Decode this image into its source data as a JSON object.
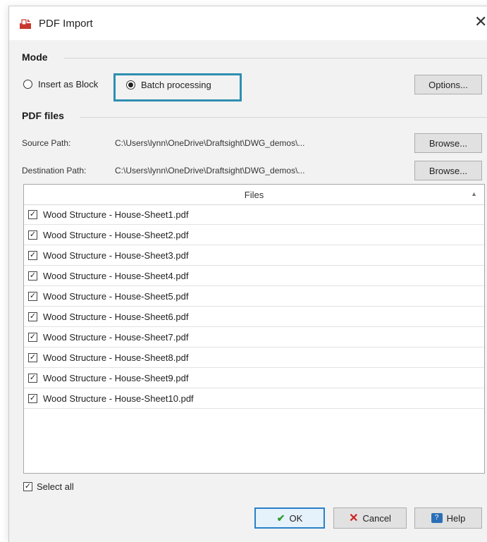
{
  "window": {
    "title": "PDF Import",
    "close": "✕",
    "app_icon": "pdf-import-icon"
  },
  "mode": {
    "label": "Mode",
    "insert_block": "Insert as Block",
    "batch": "Batch processing",
    "selected": "Batch processing",
    "options_button": "Options..."
  },
  "pdf_files": {
    "label": "PDF files",
    "source_label": "Source Path:",
    "source_value": "C:\\Users\\lynn\\OneDrive\\Draftsight\\DWG_demos\\...",
    "dest_label": "Destination Path:",
    "dest_value": "C:\\Users\\lynn\\OneDrive\\Draftsight\\DWG_demos\\...",
    "browse": "Browse..."
  },
  "files": {
    "header": "Files",
    "items": [
      "Wood Structure - House-Sheet1.pdf",
      "Wood Structure - House-Sheet2.pdf",
      "Wood Structure - House-Sheet3.pdf",
      "Wood Structure - House-Sheet4.pdf",
      "Wood Structure - House-Sheet5.pdf",
      "Wood Structure - House-Sheet6.pdf",
      "Wood Structure - House-Sheet7.pdf",
      "Wood Structure - House-Sheet8.pdf",
      "Wood Structure - House-Sheet9.pdf",
      "Wood Structure - House-Sheet10.pdf"
    ]
  },
  "select_all": "Select all",
  "buttons": {
    "ok": "OK",
    "cancel": "Cancel",
    "help": "Help"
  },
  "colors": {
    "highlight": "#2e8fb0",
    "ok_border": "#2a7fc9",
    "cancel_icon": "#d11f1f",
    "ok_icon": "#2f9a2f"
  }
}
